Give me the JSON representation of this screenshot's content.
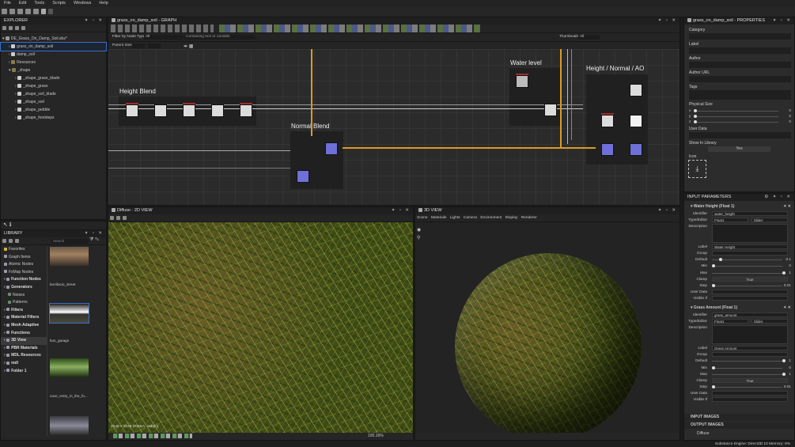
{
  "menu": [
    "File",
    "Edit",
    "Tools",
    "Scripts",
    "Windows",
    "Help"
  ],
  "explorer": {
    "title": "EXPLORER",
    "package": "DE_Grass_On_Damp_Soil.sbs*",
    "items": [
      "grass_on_damp_soil",
      "damp_soil",
      "Resources",
      "_shape",
      "_shape_grass_blade",
      "_shape_grass",
      "_shape_soil_blade",
      "_shape_soil",
      "_shape_pebble",
      "_shape_footsteps"
    ]
  },
  "graph": {
    "title": "grass_on_damp_soil - GRAPH",
    "filter_label": "Filter by Node Type:",
    "filter_value": "All",
    "search_placeholder": "Containing text or variable",
    "thumbnails_label": "Thumbnails:",
    "thumbnails_value": "All",
    "parent_size_label": "Parent Size:",
    "frames": [
      "Height Blend",
      "Normal Blend",
      "Water level",
      "Height / Normal / AO"
    ]
  },
  "properties": {
    "title": "grass_on_damp_soil - PROPERTIES",
    "labels": [
      "Category",
      "Label",
      "Author",
      "Author URL",
      "Tags",
      "Physical Size"
    ],
    "axes": [
      "x",
      "y",
      "z"
    ],
    "axis_values": [
      "0",
      "0",
      "0"
    ],
    "user_data": "User Data",
    "show_in_library": "Show In Library",
    "show_in_library_value": "Yes",
    "icon": "Icon"
  },
  "input_params": {
    "title": "INPUT PARAMETERS",
    "params": [
      {
        "header": "Water Height (Float 1)",
        "identifier": "water_height",
        "type": "Float1",
        "editor": "Slider",
        "label": "Water Height",
        "default": "0.1",
        "min": "0",
        "max": "1",
        "clamp": "True",
        "step": "0.01",
        "default_frac": 0.1,
        "max_frac": 1.0,
        "step_frac": 0.0
      },
      {
        "header": "Grass Amount (Float 1)",
        "identifier": "grass_amount",
        "type": "Float1",
        "editor": "Slider",
        "label": "Grass Amount",
        "default": "1",
        "min": "0",
        "max": "1",
        "clamp": "True",
        "step": "0.01",
        "default_frac": 1.0,
        "max_frac": 1.0,
        "step_frac": 0.0
      }
    ],
    "row_labels": [
      "Identifier",
      "Type/Editor",
      "Description",
      "Label",
      "Group",
      "Default",
      "Min",
      "Max",
      "Clamp",
      "Step",
      "User Data",
      "Visible If"
    ],
    "input_images": "INPUT IMAGES",
    "output_images": "OUTPUT IMAGES",
    "diffuse": "Diffuse"
  },
  "library": {
    "title": "LIBRARY",
    "search_placeholder": "Search",
    "categories": [
      "Favorites",
      "Graph Items",
      "Atomic Nodes",
      "FxMap Nodes",
      "Function Nodes",
      "Generators",
      "Noises",
      "Patterns",
      "Filters",
      "Material Filters",
      "Mesh Adaptive",
      "Functions",
      "3D View",
      "PBR Materials",
      "MDL Resources",
      "mdl",
      "Folder 1"
    ],
    "thumbs": [
      "bonifacio_street",
      "bus_garage",
      "cave_entry_in_the_fo..."
    ]
  },
  "view2d": {
    "title": "Diffuse - 2D VIEW",
    "status": "2048 x 2048 (RGBA, 16bpc)",
    "zoom": "100.16%"
  },
  "view3d": {
    "title": "3D VIEW",
    "menu": [
      "Scene",
      "Materials",
      "Lights",
      "Camera",
      "Environment",
      "Display",
      "Renderer"
    ]
  },
  "statusbar": "Substance Engine: Direct3D 10   Memory: 6%"
}
